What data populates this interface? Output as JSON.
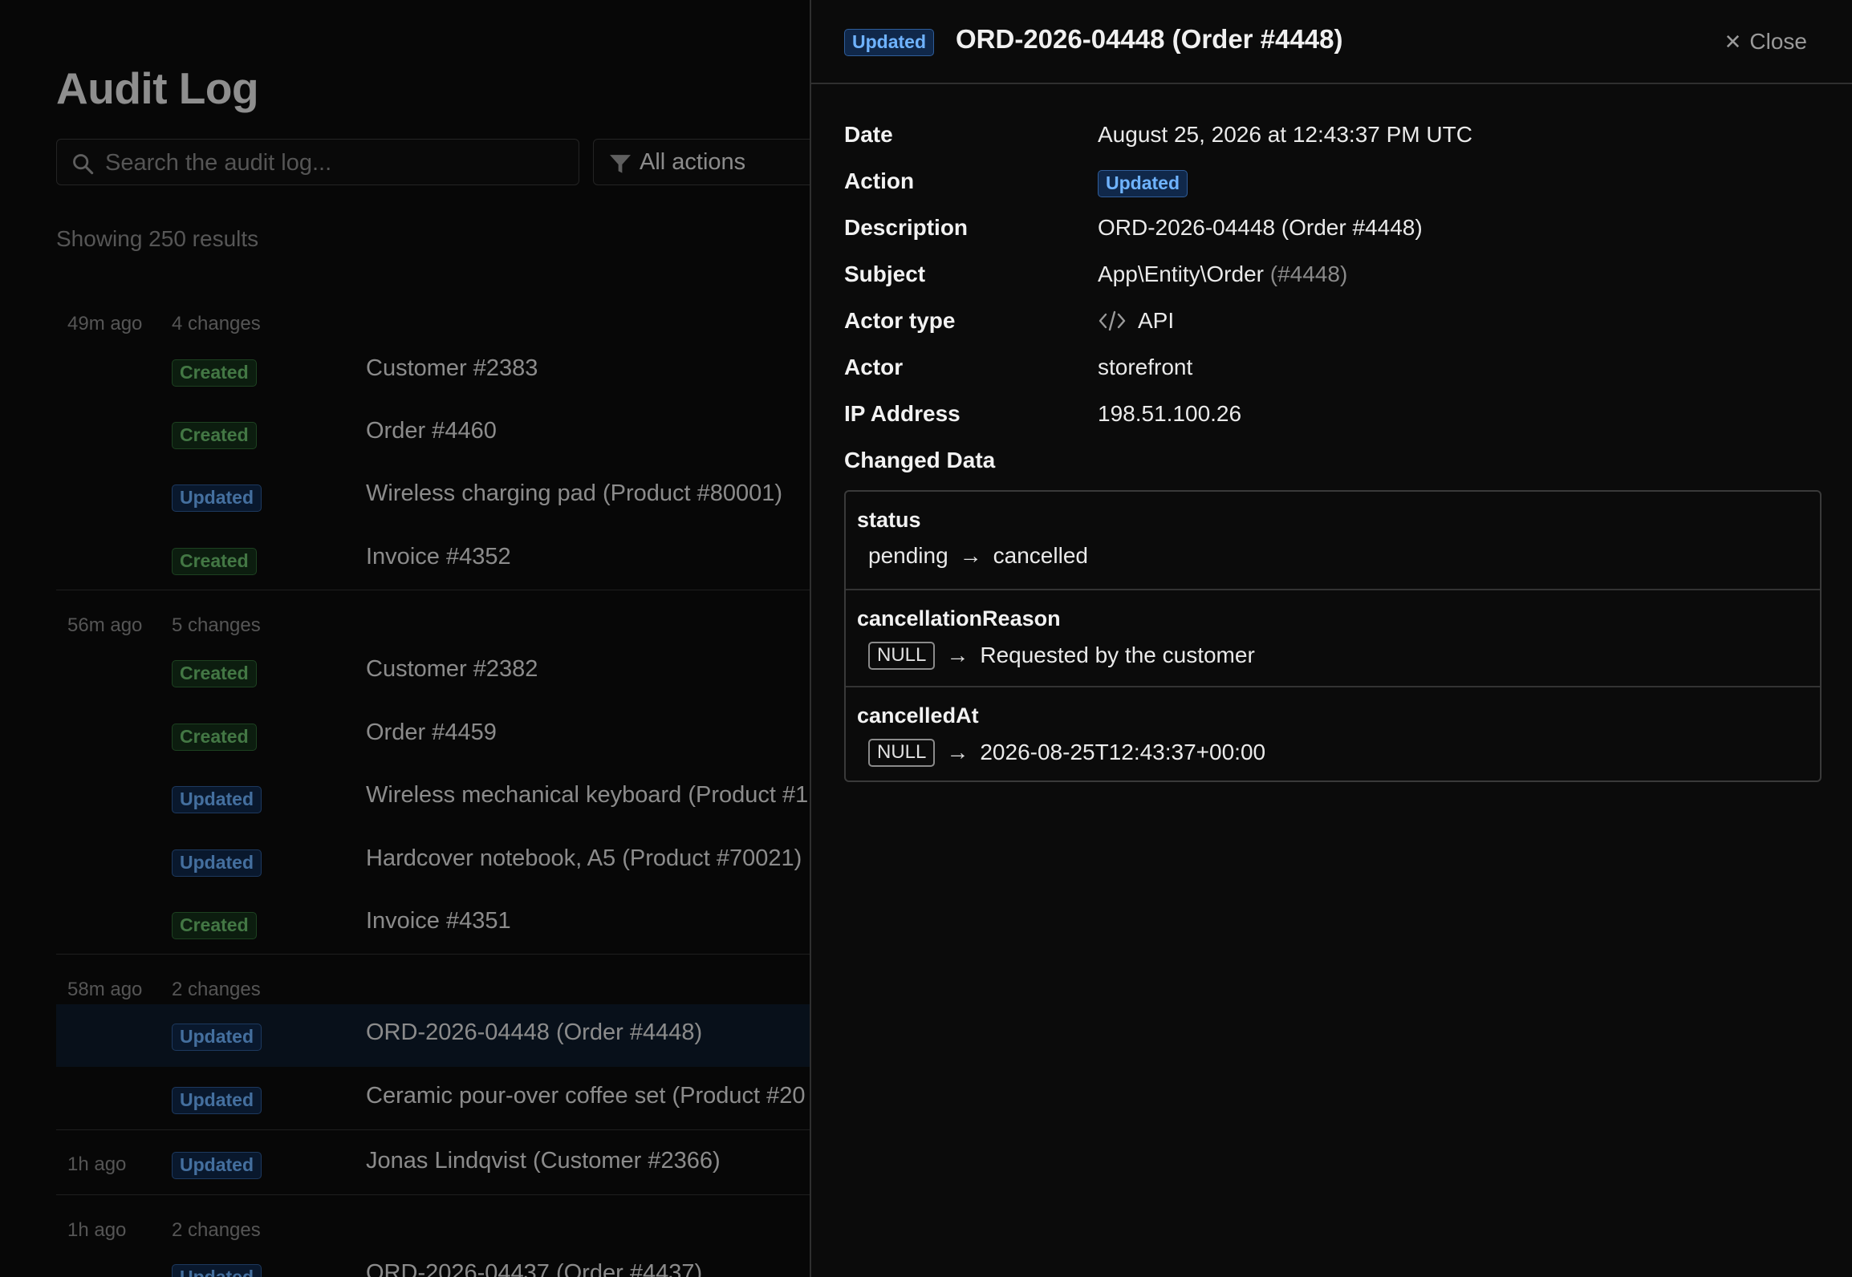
{
  "main": {
    "title": "Audit Log",
    "search_placeholder": "Search the audit log...",
    "filter_label": "All actions",
    "results_count": "Showing 250 results",
    "groups": [
      {
        "time": "49m ago",
        "count": "4 changes",
        "rows": [
          {
            "action": "Created",
            "description": "Customer #2383"
          },
          {
            "action": "Created",
            "description": "Order #4460"
          },
          {
            "action": "Updated",
            "description": "Wireless charging pad (Product #80001)"
          },
          {
            "action": "Created",
            "description": "Invoice #4352"
          }
        ]
      },
      {
        "time": "56m ago",
        "count": "5 changes",
        "rows": [
          {
            "action": "Created",
            "description": "Customer #2382"
          },
          {
            "action": "Created",
            "description": "Order #4459"
          },
          {
            "action": "Updated",
            "description": "Wireless mechanical keyboard (Product #1"
          },
          {
            "action": "Updated",
            "description": "Hardcover notebook, A5 (Product #70021)"
          },
          {
            "action": "Created",
            "description": "Invoice #4351"
          }
        ]
      },
      {
        "time": "58m ago",
        "count": "2 changes",
        "rows": [
          {
            "action": "Updated",
            "description": "ORD-2026-04448 (Order #4448)"
          },
          {
            "action": "Updated",
            "description": "Ceramic pour-over coffee set (Product #20"
          }
        ]
      },
      {
        "time": "1h ago",
        "rows": [
          {
            "action": "Updated",
            "description": "Jonas Lindqvist (Customer #2366)"
          }
        ]
      },
      {
        "time": "1h ago",
        "count": "2 changes",
        "rows": [
          {
            "action": "Updated",
            "description": "ORD-2026-04437 (Order #4437)"
          }
        ]
      }
    ]
  },
  "panel": {
    "badge": "Updated",
    "title": "ORD-2026-04448 (Order #4448)",
    "close_label": "Close",
    "fields": {
      "date_label": "Date",
      "date_value": "August 25, 2026 at 12:43:37 PM UTC",
      "action_label": "Action",
      "action_value": "Updated",
      "description_label": "Description",
      "description_value": "ORD-2026-04448 (Order #4448)",
      "subject_label": "Subject",
      "subject_value": "App\\Entity\\Order",
      "subject_id": "(#4448)",
      "actor_type_label": "Actor type",
      "actor_type_value": "API",
      "actor_label": "Actor",
      "actor_value": "storefront",
      "ip_label": "IP Address",
      "ip_value": "198.51.100.26",
      "changed_label": "Changed Data"
    },
    "changes": [
      {
        "key": "status",
        "from": "pending",
        "from_is_null": false,
        "to": "cancelled"
      },
      {
        "key": "cancellationReason",
        "from": "NULL",
        "from_is_null": true,
        "to": "Requested by the customer"
      },
      {
        "key": "cancelledAt",
        "from": "NULL",
        "from_is_null": true,
        "to": "2026-08-25T12:43:37+00:00"
      }
    ]
  },
  "colors": {
    "created_badge": "#6cc16f",
    "updated_badge": "#6fb3ff",
    "selected_row": "#0e1a2b"
  },
  "icons": [
    "search-icon",
    "filter-icon",
    "close-icon",
    "code-icon",
    "arrow-right-icon"
  ]
}
